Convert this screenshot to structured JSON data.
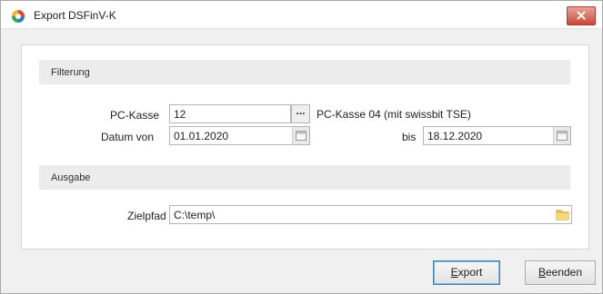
{
  "window": {
    "title": "Export DSFinV-K"
  },
  "sections": {
    "filter": {
      "title": "Filterung"
    },
    "output": {
      "title": "Ausgabe"
    }
  },
  "fields": {
    "pc_kasse": {
      "label": "PC-Kasse",
      "value": "12",
      "browse_label": "...",
      "description": "PC-Kasse 04 (mit swissbit TSE)"
    },
    "datum_von": {
      "label": "Datum von",
      "value": "01.01.2020"
    },
    "datum_bis": {
      "label": "bis",
      "value": "18.12.2020"
    },
    "zielpfad": {
      "label": "Zielpfad",
      "value": "C:\\temp\\"
    }
  },
  "buttons": {
    "export": {
      "mnemonic": "E",
      "rest": "xport"
    },
    "beenden": {
      "mnemonic": "B",
      "rest": "eenden"
    }
  },
  "colors": {
    "close_button": "#c9493b",
    "default_button_border": "#3c7fb1"
  }
}
